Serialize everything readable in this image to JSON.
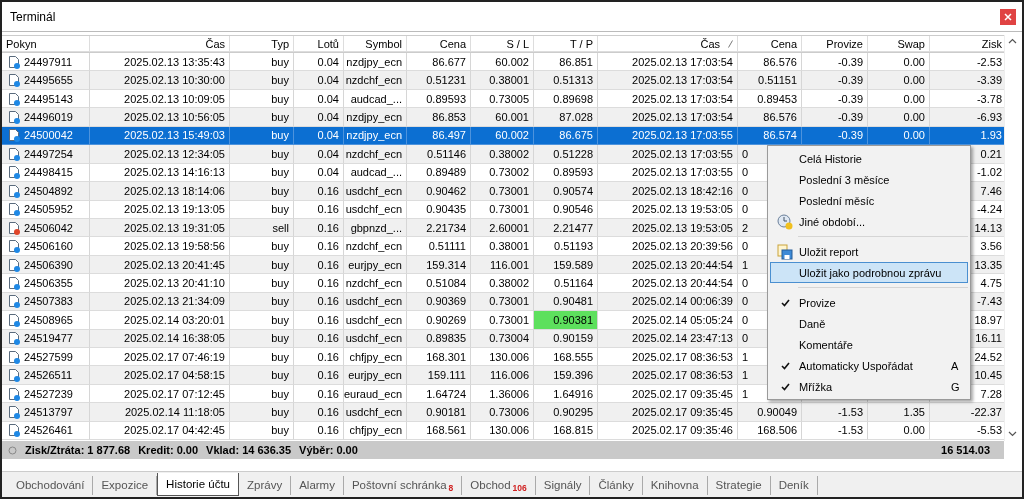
{
  "window": {
    "title": "Terminál"
  },
  "table": {
    "columns": [
      {
        "label": "Pokyn",
        "sorted": false
      },
      {
        "label": "Čas",
        "sorted": false
      },
      {
        "label": "Typ",
        "sorted": false
      },
      {
        "label": "Lotů",
        "sorted": false
      },
      {
        "label": "Symbol",
        "sorted": false
      },
      {
        "label": "Cena",
        "sorted": false
      },
      {
        "label": "S / L",
        "sorted": false
      },
      {
        "label": "T / P",
        "sorted": false
      },
      {
        "label": "Čas",
        "sorted": true
      },
      {
        "label": "Cena",
        "sorted": false
      },
      {
        "label": "Provize",
        "sorted": false
      },
      {
        "label": "Swap",
        "sorted": false
      },
      {
        "label": "Zisk",
        "sorted": false
      }
    ],
    "rows": [
      {
        "cells": [
          "24497911",
          "2025.02.13 13:35:43",
          "buy",
          "0.04",
          "nzdjpy_ecn",
          "86.677",
          "60.002",
          "86.851",
          "2025.02.13 17:03:54",
          "86.576",
          "-0.39",
          "0.00",
          "-2.53"
        ],
        "color": "#1e88e5",
        "selected": false,
        "covered": false,
        "tp_hit": false
      },
      {
        "cells": [
          "24495655",
          "2025.02.13 10:30:00",
          "buy",
          "0.04",
          "nzdchf_ecn",
          "0.51231",
          "0.38001",
          "0.51313",
          "2025.02.13 17:03:54",
          "0.51151",
          "-0.39",
          "0.00",
          "-3.39"
        ],
        "color": "#1e88e5",
        "selected": false,
        "covered": false,
        "tp_hit": false
      },
      {
        "cells": [
          "24495143",
          "2025.02.13 10:09:05",
          "buy",
          "0.04",
          "audcad_...",
          "0.89593",
          "0.73005",
          "0.89698",
          "2025.02.13 17:03:54",
          "0.89453",
          "-0.39",
          "0.00",
          "-3.78"
        ],
        "color": "#1e88e5",
        "selected": false,
        "covered": false,
        "tp_hit": false
      },
      {
        "cells": [
          "24496019",
          "2025.02.13 10:56:05",
          "buy",
          "0.04",
          "nzdjpy_ecn",
          "86.853",
          "60.001",
          "87.028",
          "2025.02.13 17:03:54",
          "86.576",
          "-0.39",
          "0.00",
          "-6.93"
        ],
        "color": "#1e88e5",
        "selected": false,
        "covered": false,
        "tp_hit": false
      },
      {
        "cells": [
          "24500042",
          "2025.02.13 15:49:03",
          "buy",
          "0.04",
          "nzdjpy_ecn",
          "86.497",
          "60.002",
          "86.675",
          "2025.02.13 17:03:55",
          "86.574",
          "-0.39",
          "0.00",
          "1.93"
        ],
        "color": "#1e88e5",
        "selected": true,
        "covered": false,
        "tp_hit": false
      },
      {
        "cells": [
          "24497254",
          "2025.02.13 12:34:05",
          "buy",
          "0.04",
          "nzdchf_ecn",
          "0.51146",
          "0.38002",
          "0.51228",
          "2025.02.13 17:03:55",
          "0",
          null,
          null,
          "0.21"
        ],
        "color": "#1e88e5",
        "selected": false,
        "covered": true,
        "tp_hit": false
      },
      {
        "cells": [
          "24498415",
          "2025.02.13 14:16:13",
          "buy",
          "0.04",
          "audcad_...",
          "0.89489",
          "0.73002",
          "0.89593",
          "2025.02.13 17:03:55",
          "0",
          null,
          null,
          "-1.02"
        ],
        "color": "#1e88e5",
        "selected": false,
        "covered": true,
        "tp_hit": false
      },
      {
        "cells": [
          "24504892",
          "2025.02.13 18:14:06",
          "buy",
          "0.16",
          "usdchf_ecn",
          "0.90462",
          "0.73001",
          "0.90574",
          "2025.02.13 18:42:16",
          "0",
          null,
          null,
          "7.46"
        ],
        "color": "#1e88e5",
        "selected": false,
        "covered": true,
        "tp_hit": false
      },
      {
        "cells": [
          "24505952",
          "2025.02.13 19:13:05",
          "buy",
          "0.16",
          "usdchf_ecn",
          "0.90435",
          "0.73001",
          "0.90546",
          "2025.02.13 19:53:05",
          "0",
          null,
          null,
          "-4.24"
        ],
        "color": "#1e88e5",
        "selected": false,
        "covered": true,
        "tp_hit": false
      },
      {
        "cells": [
          "24506042",
          "2025.02.13 19:31:05",
          "sell",
          "0.16",
          "gbpnzd_...",
          "2.21734",
          "2.60001",
          "2.21477",
          "2025.02.13 19:53:05",
          "2",
          null,
          null,
          "14.13"
        ],
        "color": "#e0462a",
        "selected": false,
        "covered": true,
        "tp_hit": false
      },
      {
        "cells": [
          "24506160",
          "2025.02.13 19:58:56",
          "buy",
          "0.16",
          "nzdchf_ecn",
          "0.51111",
          "0.38001",
          "0.51193",
          "2025.02.13 20:39:56",
          "0",
          null,
          null,
          "3.56"
        ],
        "color": "#1e88e5",
        "selected": false,
        "covered": true,
        "tp_hit": false
      },
      {
        "cells": [
          "24506390",
          "2025.02.13 20:41:45",
          "buy",
          "0.16",
          "eurjpy_ecn",
          "159.314",
          "116.001",
          "159.589",
          "2025.02.13 20:44:54",
          "1",
          null,
          null,
          "13.35"
        ],
        "color": "#1e88e5",
        "selected": false,
        "covered": true,
        "tp_hit": false
      },
      {
        "cells": [
          "24506355",
          "2025.02.13 20:41:10",
          "buy",
          "0.16",
          "nzdchf_ecn",
          "0.51084",
          "0.38002",
          "0.51164",
          "2025.02.13 20:44:54",
          "0",
          null,
          null,
          "4.75"
        ],
        "color": "#1e88e5",
        "selected": false,
        "covered": true,
        "tp_hit": false
      },
      {
        "cells": [
          "24507383",
          "2025.02.13 21:34:09",
          "buy",
          "0.16",
          "usdchf_ecn",
          "0.90369",
          "0.73001",
          "0.90481",
          "2025.02.14 00:06:39",
          "0",
          null,
          null,
          "-7.43"
        ],
        "color": "#1e88e5",
        "selected": false,
        "covered": true,
        "tp_hit": false
      },
      {
        "cells": [
          "24508965",
          "2025.02.14 03:20:01",
          "buy",
          "0.16",
          "usdchf_ecn",
          "0.90269",
          "0.73001",
          "0.90381",
          "2025.02.14 05:05:24",
          "0",
          null,
          null,
          "18.97"
        ],
        "color": "#1e88e5",
        "selected": false,
        "covered": true,
        "tp_hit": true
      },
      {
        "cells": [
          "24519477",
          "2025.02.14 16:38:05",
          "buy",
          "0.16",
          "usdchf_ecn",
          "0.89835",
          "0.73004",
          "0.90159",
          "2025.02.14 23:47:13",
          "0",
          null,
          null,
          "16.11"
        ],
        "color": "#1e88e5",
        "selected": false,
        "covered": true,
        "tp_hit": false
      },
      {
        "cells": [
          "24527599",
          "2025.02.17 07:46:19",
          "buy",
          "0.16",
          "chfjpy_ecn",
          "168.301",
          "130.006",
          "168.555",
          "2025.02.17 08:36:53",
          "1",
          null,
          null,
          "24.52"
        ],
        "color": "#1e88e5",
        "selected": false,
        "covered": true,
        "tp_hit": false
      },
      {
        "cells": [
          "24526511",
          "2025.02.17 04:58:15",
          "buy",
          "0.16",
          "eurjpy_ecn",
          "159.111",
          "116.006",
          "159.396",
          "2025.02.17 08:36:53",
          "1",
          null,
          null,
          "10.45"
        ],
        "color": "#1e88e5",
        "selected": false,
        "covered": true,
        "tp_hit": false
      },
      {
        "cells": [
          "24527239",
          "2025.02.17 07:12:45",
          "buy",
          "0.16",
          "euraud_ecn",
          "1.64724",
          "1.36006",
          "1.64916",
          "2025.02.17 09:35:45",
          "1",
          null,
          null,
          "7.28"
        ],
        "color": "#1e88e5",
        "selected": false,
        "covered": true,
        "tp_hit": false
      },
      {
        "cells": [
          "24513797",
          "2025.02.14 11:18:05",
          "buy",
          "0.16",
          "usdchf_ecn",
          "0.90181",
          "0.73006",
          "0.90295",
          "2025.02.17 09:35:45",
          "0.90049",
          "-1.53",
          "1.35",
          "-22.37"
        ],
        "color": "#1e88e5",
        "selected": false,
        "covered": false,
        "tp_hit": false
      },
      {
        "cells": [
          "24526461",
          "2025.02.17 04:42:45",
          "buy",
          "0.16",
          "chfjpy_ecn",
          "168.561",
          "130.006",
          "168.815",
          "2025.02.17 09:35:46",
          "168.506",
          "-1.53",
          "0.00",
          "-5.53"
        ],
        "color": "#1e88e5",
        "selected": false,
        "covered": false,
        "tp_hit": false
      }
    ]
  },
  "summary": {
    "items": [
      "Zisk/Ztráta: 1 877.68",
      "Kredit: 0.00",
      "Vklad: 14 636.35",
      "Výběr: 0.00"
    ],
    "total": "16 514.03"
  },
  "context_menu": {
    "items": [
      {
        "kind": "plain",
        "label": "Celá Historie",
        "checked": false,
        "selected": false
      },
      {
        "kind": "plain",
        "label": "Poslední 3 měsíce",
        "checked": false,
        "selected": false
      },
      {
        "kind": "plain",
        "label": "Poslední měsíc",
        "checked": false,
        "selected": false
      },
      {
        "kind": "custom",
        "label": "Jiné období...",
        "checked": false,
        "selected": false
      },
      {
        "kind": "separator"
      },
      {
        "kind": "save",
        "label": "Uložit report",
        "checked": false,
        "selected": false
      },
      {
        "kind": "plain",
        "label": "Uložit jako podrobnou zprávu",
        "checked": false,
        "selected": true
      },
      {
        "kind": "separator"
      },
      {
        "kind": "plain",
        "label": "Provize",
        "checked": true,
        "selected": false
      },
      {
        "kind": "plain",
        "label": "Daně",
        "checked": false,
        "selected": false
      },
      {
        "kind": "plain",
        "label": "Komentáře",
        "checked": false,
        "selected": false
      },
      {
        "kind": "plain",
        "label": "Automaticky Uspořádat",
        "shortcut": "A",
        "checked": true,
        "selected": false
      },
      {
        "kind": "plain",
        "label": "Mřížka",
        "shortcut": "G",
        "checked": true,
        "selected": false
      }
    ]
  },
  "tabs": [
    {
      "label": "Obchodování",
      "selected": false
    },
    {
      "label": "Expozice",
      "selected": false
    },
    {
      "label": "Historie účtu",
      "selected": true
    },
    {
      "label": "Zprávy",
      "selected": false
    },
    {
      "label": "Alarmy",
      "selected": false
    },
    {
      "label": "Poštovní schránka",
      "badge": "8",
      "selected": false
    },
    {
      "label": "Obchod",
      "badge": "106",
      "selected": false
    },
    {
      "label": "Signály",
      "selected": false
    },
    {
      "label": "Články",
      "selected": false
    },
    {
      "label": "Knihovna",
      "selected": false
    },
    {
      "label": "Strategie",
      "selected": false
    },
    {
      "label": "Deník",
      "selected": false
    }
  ]
}
